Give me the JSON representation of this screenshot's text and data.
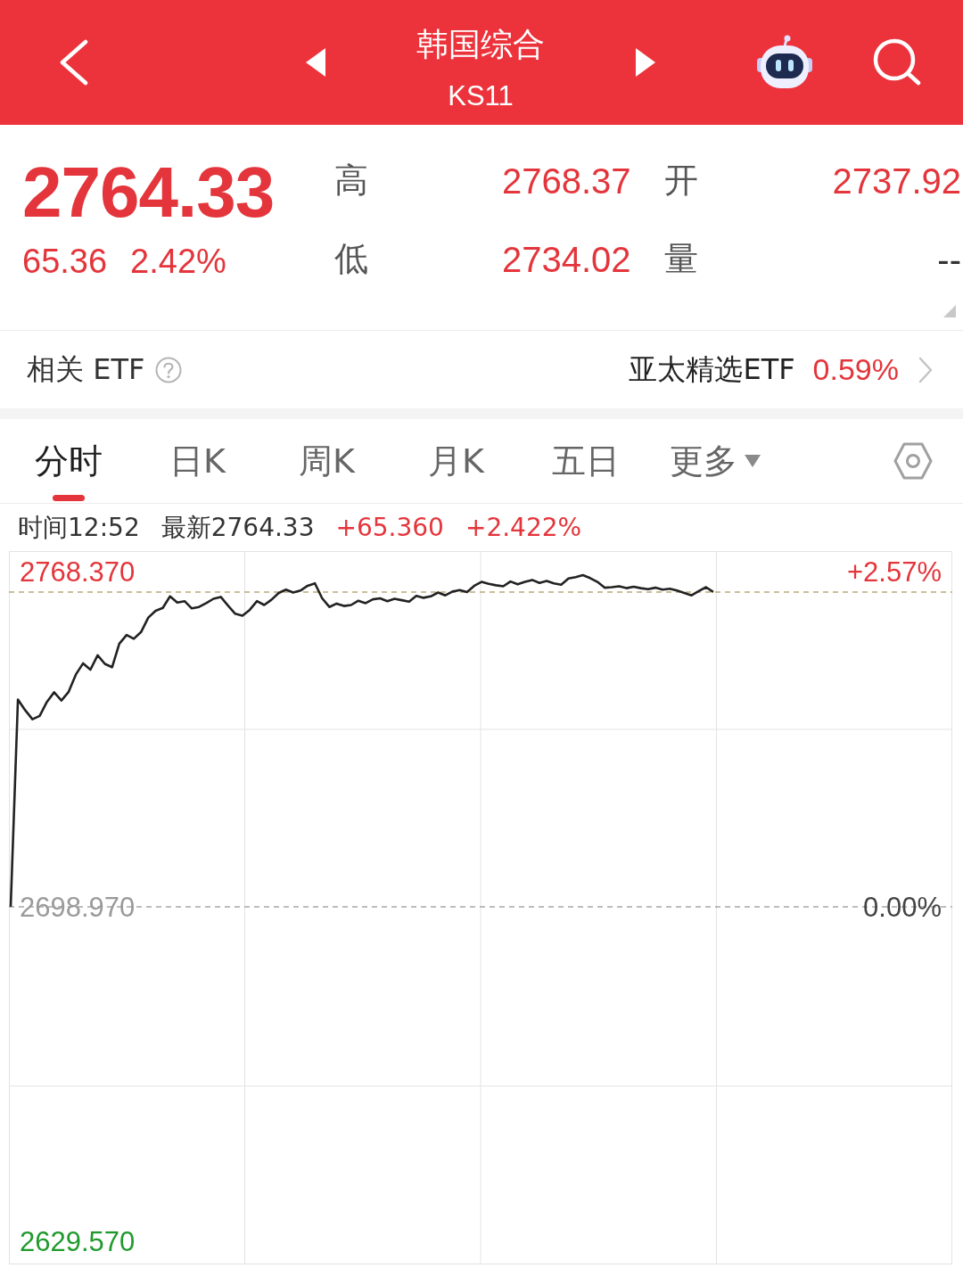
{
  "header": {
    "title": "韩国综合",
    "code": "KS11"
  },
  "quote": {
    "price": "2764.33",
    "change": "65.36",
    "change_pct": "2.42%",
    "color": "#e3353b",
    "stats": [
      {
        "label": "高",
        "value": "2768.37",
        "color": "#e3353b"
      },
      {
        "label": "开",
        "value": "2737.92",
        "color": "#e3353b"
      },
      {
        "label": "低",
        "value": "2734.02",
        "color": "#e3353b"
      },
      {
        "label": "量",
        "value": "--",
        "color": "#333333"
      }
    ]
  },
  "related_etf": {
    "label": "相关 ETF",
    "fund": "亚太精选ETF",
    "change": "0.59%",
    "color": "#e3353b"
  },
  "tabs": [
    {
      "label": "分时",
      "selected": true,
      "kind": "view"
    },
    {
      "label": "日K",
      "selected": false,
      "kind": "view"
    },
    {
      "label": "周K",
      "selected": false,
      "kind": "view"
    },
    {
      "label": "月K",
      "selected": false,
      "kind": "view"
    },
    {
      "label": "五日",
      "selected": false,
      "kind": "view"
    },
    {
      "label": "更多",
      "selected": false,
      "kind": "menu"
    }
  ],
  "chart": {
    "info": [
      {
        "text": "时间12:52",
        "color": "#333333"
      },
      {
        "text": "最新2764.33",
        "color": "#333333"
      },
      {
        "text": "+65.360",
        "color": "#e3353b"
      },
      {
        "text": "+2.422%",
        "color": "#e3353b"
      }
    ],
    "percent_labels": [
      "+2.57%",
      "0.00%"
    ],
    "chart_data": {
      "type": "line",
      "ylim": [
        2624.8,
        2772.8
      ],
      "yticks": [
        {
          "value": 2768.37,
          "label": "2768.370"
        },
        {
          "value": 2698.97,
          "label": "2698.970"
        },
        {
          "value": 2629.57,
          "label": "2629.570"
        }
      ],
      "ref_lines": [
        {
          "axis": "y",
          "value": 2698.97,
          "color": "#a8a8a8"
        },
        {
          "axis": "y",
          "value": 2764.3,
          "color": "#bba878"
        }
      ],
      "categories": [
        null,
        null,
        null,
        null,
        null,
        null,
        null,
        null,
        null,
        null,
        null,
        null,
        null,
        null,
        null,
        null,
        null,
        null,
        null,
        null,
        null,
        null,
        null,
        null,
        null,
        null,
        null,
        null,
        null,
        null,
        null,
        null,
        null,
        null,
        null,
        null,
        null,
        null,
        null,
        null,
        null,
        null,
        null,
        null,
        null,
        null,
        null,
        null,
        null,
        null,
        null,
        null,
        null,
        null,
        null,
        null,
        null,
        null,
        null,
        null,
        null,
        null,
        null,
        null,
        null,
        null,
        null,
        null,
        null,
        null,
        null,
        null,
        null,
        null,
        null,
        null,
        null,
        null,
        null,
        null,
        null,
        null,
        null,
        null,
        null,
        null,
        null,
        null,
        null,
        null,
        null,
        null,
        null,
        null,
        null,
        null,
        null,
        null,
        null,
        null,
        null,
        null,
        null,
        null,
        null,
        null,
        null,
        null,
        null,
        null,
        null,
        null,
        null,
        null,
        null,
        null,
        null,
        null,
        null,
        null,
        null,
        null,
        null,
        null,
        null,
        null,
        null,
        null,
        null,
        null,
        null
      ],
      "values": [
        2699.0,
        2742.0,
        2739.8,
        2737.9,
        2738.6,
        2741.5,
        2743.5,
        2741.8,
        2743.6,
        2747.2,
        2749.5,
        2748.2,
        2751.2,
        2749.4,
        2748.7,
        2753.6,
        2755.4,
        2754.6,
        2756.0,
        2759.0,
        2760.4,
        2761.0,
        2763.4,
        2762.1,
        2762.4,
        2760.9,
        2761.2,
        2762.0,
        2762.9,
        2763.3,
        2761.5,
        2759.8,
        2759.4,
        2760.6,
        2762.4,
        2761.6,
        2762.7,
        2764.1,
        2764.8,
        2764.2,
        2764.6,
        2765.6,
        2766.1,
        2763.0,
        2761.2,
        2761.9,
        2761.4,
        2761.6,
        2762.5,
        2762.0,
        2762.8,
        2763.0,
        2762.4,
        2762.9,
        2762.6,
        2762.3,
        2763.5,
        2763.1,
        2763.4,
        2764.2,
        2763.6,
        2764.4,
        2764.7,
        2764.3,
        2765.6,
        2766.4,
        2766.0,
        2765.7,
        2765.5,
        2766.5,
        2765.9,
        2766.4,
        2766.8,
        2766.2,
        2766.6,
        2766.1,
        2765.8,
        2767.1,
        2767.4,
        2767.8,
        2767.2,
        2766.4,
        2765.2,
        2765.3,
        2765.5,
        2765.1,
        2765.4,
        2765.1,
        2764.9,
        2765.2,
        2764.8,
        2765.0,
        2764.6,
        2764.1,
        2763.6,
        2764.5,
        2765.3,
        2764.3,
        null,
        null,
        null,
        null,
        null,
        null,
        null,
        null,
        null,
        null,
        null,
        null,
        null,
        null,
        null,
        null,
        null,
        null,
        null,
        null,
        null,
        null,
        null,
        null,
        null,
        null,
        null,
        null,
        null,
        null,
        null,
        null,
        null
      ]
    }
  }
}
